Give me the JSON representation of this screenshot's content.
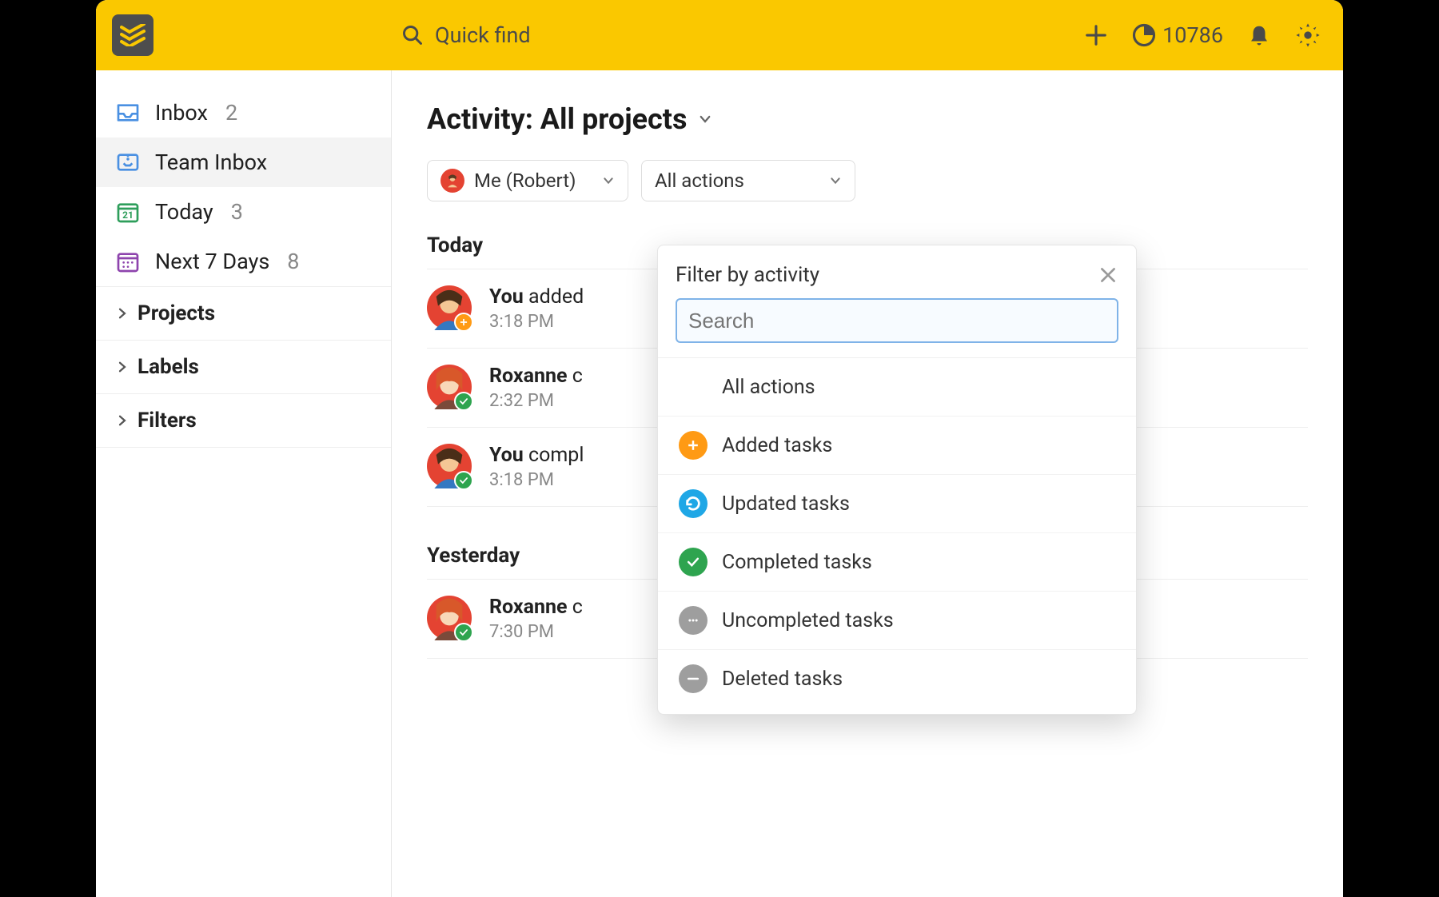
{
  "header": {
    "search_placeholder": "Quick find",
    "karma_points": "10786"
  },
  "sidebar": {
    "items": [
      {
        "label": "Inbox",
        "count": "2"
      },
      {
        "label": "Team Inbox",
        "count": ""
      },
      {
        "label": "Today",
        "count": "3"
      },
      {
        "label": "Next 7 Days",
        "count": "8"
      }
    ],
    "sections": [
      {
        "label": "Projects"
      },
      {
        "label": "Labels"
      },
      {
        "label": "Filters"
      }
    ]
  },
  "main": {
    "title": "Activity: All projects",
    "filter_user": "Me (Robert)",
    "filter_action": "All actions"
  },
  "activity": {
    "groups": [
      {
        "label": "Today",
        "items": [
          {
            "actor": "You",
            "verb": "added",
            "time": "3:18 PM",
            "badge": "plus",
            "avatar": "robert"
          },
          {
            "actor": "Roxanne",
            "verb": "c",
            "time": "2:32 PM",
            "badge": "check",
            "avatar": "roxanne"
          },
          {
            "actor": "You",
            "verb": "compl",
            "time": "3:18 PM",
            "badge": "check",
            "avatar": "robert"
          }
        ]
      },
      {
        "label": "Yesterday",
        "items": [
          {
            "actor": "Roxanne",
            "verb": "c",
            "time": "7:30 PM",
            "badge": "check",
            "avatar": "roxanne"
          }
        ]
      }
    ]
  },
  "popover": {
    "title": "Filter by activity",
    "search_placeholder": "Search",
    "options": [
      {
        "label": "All actions",
        "icon": "none"
      },
      {
        "label": "Added tasks",
        "icon": "plus"
      },
      {
        "label": "Updated tasks",
        "icon": "update"
      },
      {
        "label": "Completed tasks",
        "icon": "complete"
      },
      {
        "label": "Uncompleted tasks",
        "icon": "uncomplete"
      },
      {
        "label": "Deleted tasks",
        "icon": "delete"
      }
    ]
  }
}
